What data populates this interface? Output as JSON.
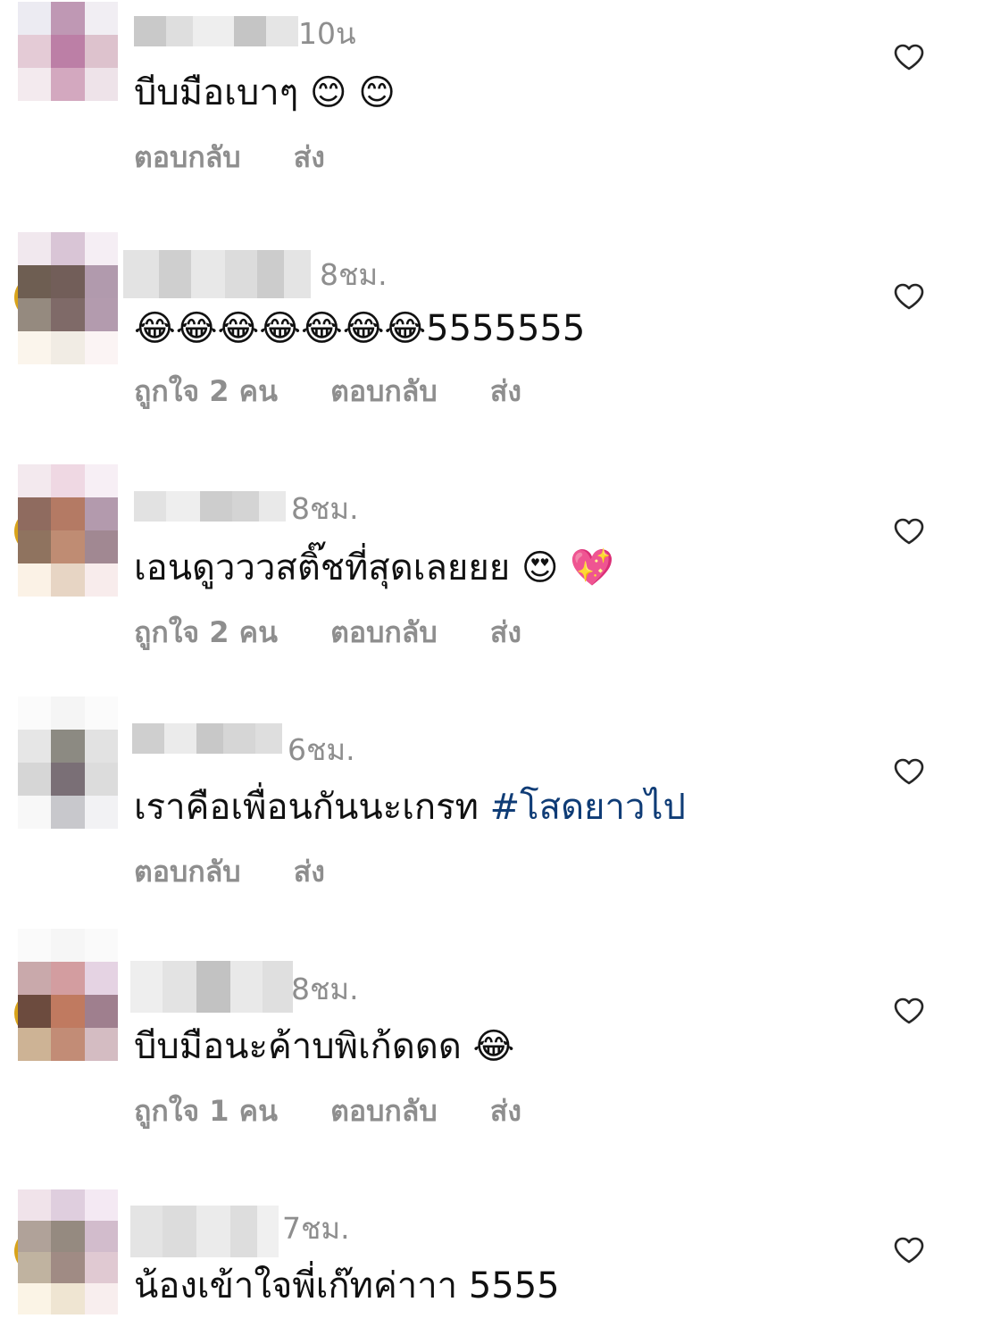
{
  "colors": {
    "background": "#ffffff",
    "text": "#111111",
    "meta": "#8e8e8e",
    "hashtag": "#0f3c76",
    "heart_stroke": "#262626"
  },
  "comments": [
    {
      "time": "10น",
      "text": "บีบมือเบาๆ 😊 😊",
      "hashtag": "",
      "likes_label": "",
      "reply_label": "ตอบกลับ",
      "send_label": "ส่ง",
      "like_icon": "heart-outline-icon"
    },
    {
      "time": "8ชม.",
      "text": "😂😂😂😂😂😂😂5555555",
      "hashtag": "",
      "likes_label": "ถูกใจ 2 คน",
      "reply_label": "ตอบกลับ",
      "send_label": "ส่ง",
      "like_icon": "heart-outline-icon"
    },
    {
      "time": "8ชม.",
      "text": "เอนดูวววสติ๊ชที่สุดเลยยย 😍 💖",
      "hashtag": "",
      "likes_label": "ถูกใจ 2 คน",
      "reply_label": "ตอบกลับ",
      "send_label": "ส่ง",
      "like_icon": "heart-outline-icon"
    },
    {
      "time": "6ชม.",
      "text": "เราคือเพื่อนกันนะเกรท ",
      "hashtag": "#โสดยาวไป",
      "likes_label": "",
      "reply_label": "ตอบกลับ",
      "send_label": "ส่ง",
      "like_icon": "heart-outline-icon"
    },
    {
      "time": "8ชม.",
      "text": "บีบมือนะค้าบพิเก้ดดด 😂",
      "hashtag": "",
      "likes_label": "ถูกใจ 1 คน",
      "reply_label": "ตอบกลับ",
      "send_label": "ส่ง",
      "like_icon": "heart-outline-icon"
    },
    {
      "time": "7ชม.",
      "text": "น้องเข้าใจพี่เก๊ทค่าาา 5555",
      "hashtag": "",
      "likes_label": "",
      "reply_label": "",
      "send_label": "",
      "like_icon": "heart-outline-icon"
    }
  ]
}
